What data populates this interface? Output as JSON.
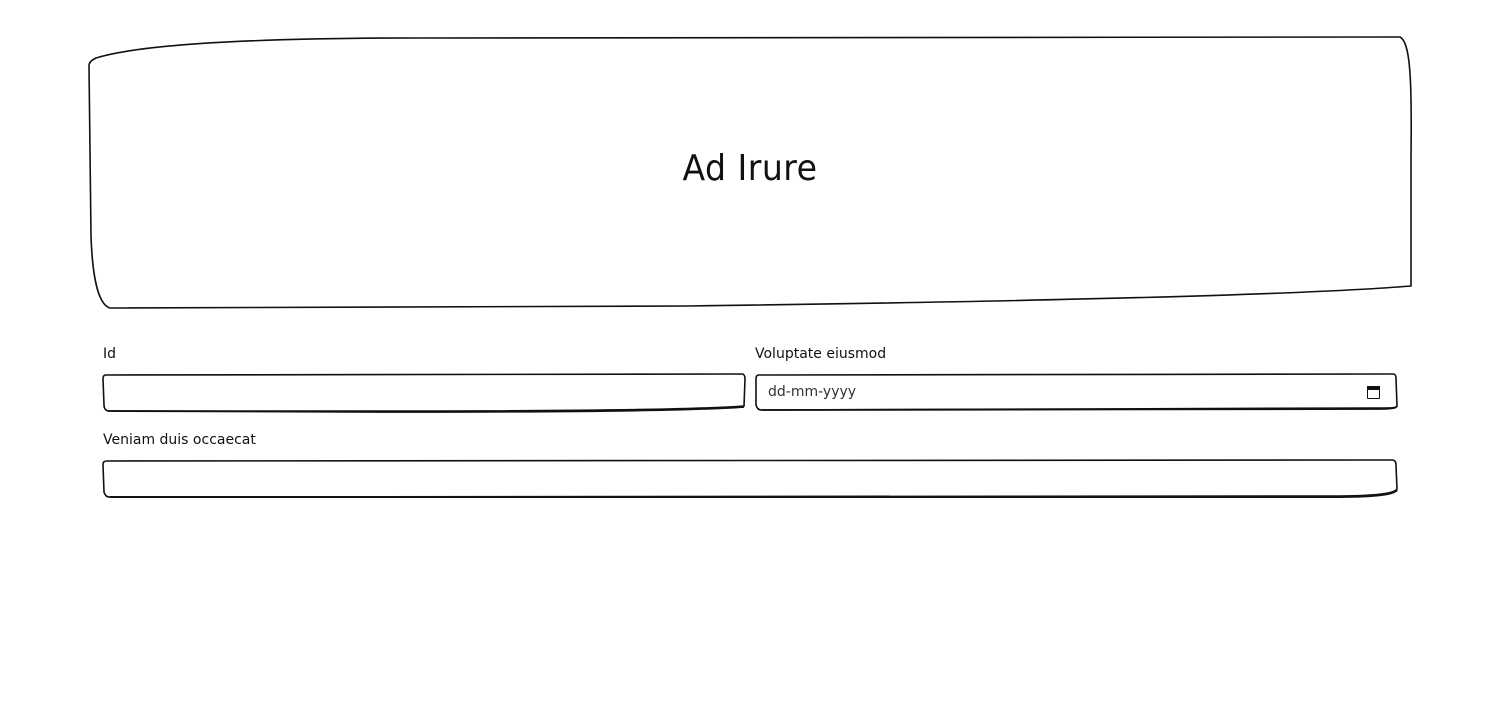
{
  "hero": {
    "title": "Ad Irure"
  },
  "form": {
    "field_id": {
      "label": "Id",
      "value": "",
      "placeholder": ""
    },
    "field_date": {
      "label": "Voluptate eiusmod",
      "placeholder": "dd-mm-yyyy",
      "icon": "calendar-icon"
    },
    "field_veniam": {
      "label": "Veniam duis occaecat",
      "value": "",
      "placeholder": ""
    }
  }
}
